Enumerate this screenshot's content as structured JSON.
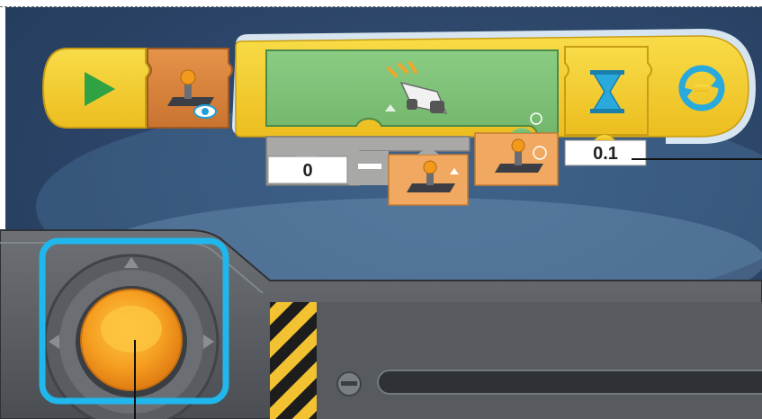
{
  "program": {
    "sensor_offset_value": "0",
    "operator_symbol": "−",
    "wait_seconds": "0.1"
  },
  "icons": {
    "start": "play-triangle-icon",
    "watch_sensor": "joystick-eye-icon",
    "motor": "vehicle-motor-icon",
    "up_sensor": "joystick-up-icon",
    "steer_sensor": "joystick-steer-icon",
    "wait": "hourglass-icon",
    "loop": "loop-arrows-icon"
  },
  "colors": {
    "block_yellow": "#f2cb2c",
    "block_orange": "#d8853c",
    "block_green": "#7fc27a",
    "joystick_orange": "#f39a1c",
    "highlight_cyan": "#1fb7ec",
    "background_navy": "#2b4467"
  }
}
